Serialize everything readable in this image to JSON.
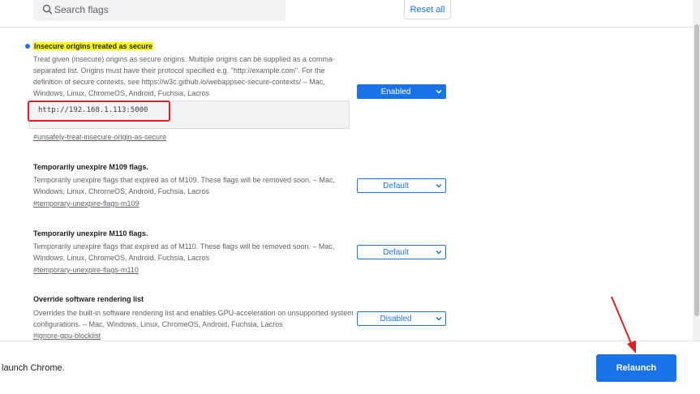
{
  "search": {
    "placeholder": "Search flags"
  },
  "toolbar": {
    "reset_label": "Reset all"
  },
  "flags": [
    {
      "title": "Insecure origins treated as secure",
      "description": "Treat given (insecure) origins as secure origins. Multiple origins can be supplied as a comma-separated list. Origins must have their protocol specified e.g. \"http://example.com\". For the definition of secure contexts, see https://w3c.github.io/webappsec-secure-contexts/ – Mac, Windows, Linux, ChromeOS, Android, Fuchsia, Lacros",
      "input_value": "http://192.168.1.113:5000",
      "link": "#unsafely-treat-insecure-origin-as-secure",
      "selected": "Enabled"
    },
    {
      "title": "Temporarily unexpire M109 flags.",
      "description": "Temporarily unexpire flags that expired as of M109. These flags will be removed soon. – Mac, Windows, Linux, ChromeOS, Android, Fuchsia, Lacros",
      "link": "#temporary-unexpire-flags-m109",
      "selected": "Default"
    },
    {
      "title": "Temporarily unexpire M110 flags.",
      "description": "Temporarily unexpire flags that expired as of M110. These flags will be removed soon. – Mac, Windows, Linux, ChromeOS, Android, Fuchsia, Lacros",
      "link": "#temporary-unexpire-flags-m110",
      "selected": "Default"
    },
    {
      "title": "Override software rendering list",
      "description": "Overrides the built-in software rendering list and enables GPU-acceleration on unsupported system configurations. – Mac, Windows, Linux, ChromeOS, Android, Fuchsia, Lacros",
      "link": "#ignore-gpu-blocklist",
      "selected": "Disabled"
    }
  ],
  "bottom": {
    "message": "launch Chrome.",
    "relaunch_label": "Relaunch"
  },
  "colors": {
    "accent": "#1a73e8",
    "highlight": "#ffff00",
    "annotation": "#e02020"
  }
}
